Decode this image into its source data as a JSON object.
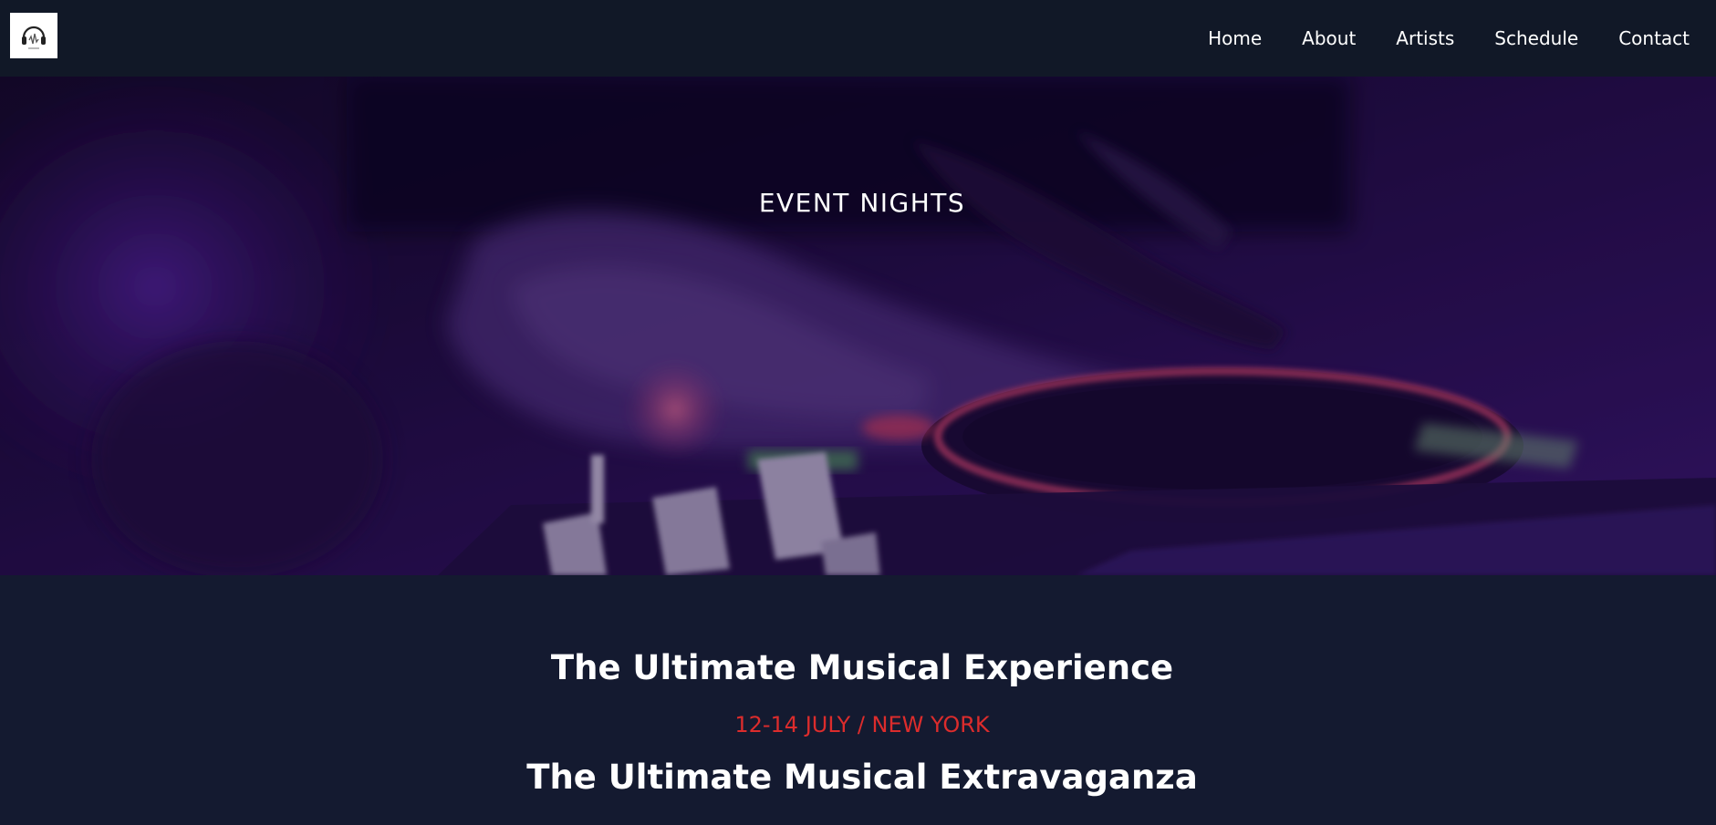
{
  "nav": {
    "logo_icon": "headphones-logo-icon",
    "links": [
      "Home",
      "About",
      "Artists",
      "Schedule",
      "Contact"
    ]
  },
  "hero": {
    "title": "EVENT NIGHTS"
  },
  "content": {
    "headline": "The Ultimate Musical Experience",
    "dateline": "12-14 JULY / NEW YORK",
    "subheadline": "The Ultimate Musical Extravaganza"
  },
  "colors": {
    "nav_bg": "#111827",
    "page_bg": "#141a30",
    "accent_red": "#dc2c2c",
    "hero_purple": "#4b1a8a"
  }
}
